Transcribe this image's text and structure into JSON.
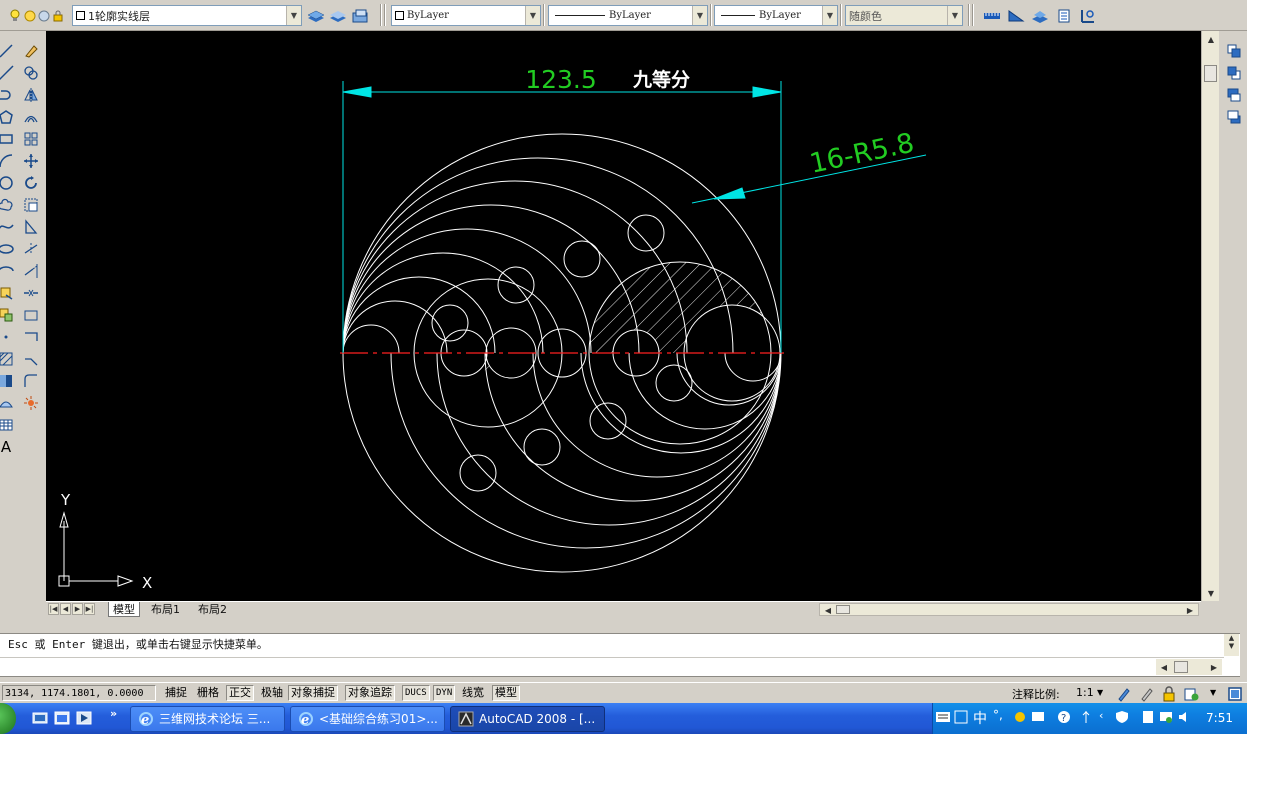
{
  "toolbar": {
    "layer_name": "1轮廓实线层",
    "color_combo": "ByLayer",
    "linetype_combo": "ByLayer",
    "lineweight_combo": "ByLayer",
    "plotstyle_combo": "随颜色"
  },
  "drawing": {
    "dimension_value": "123.5",
    "dimension_note": "九等分",
    "radius_label": "16-R5.8",
    "ucs_y": "Y",
    "ucs_x": "X",
    "colors": {
      "background": "#000000",
      "geometry": "#ffffff",
      "dimension": "#00ffff",
      "dim_text": "#00cc00",
      "centerline": "#ff0000"
    }
  },
  "tabs": [
    "模型",
    "布局1",
    "布局2"
  ],
  "command": {
    "line": "Esc 或 Enter 键退出，或单击右键显示快捷菜单。"
  },
  "status": {
    "coords": "3134, 1174.1801, 0.0000",
    "buttons": [
      {
        "label": "捕捉",
        "on": false
      },
      {
        "label": "栅格",
        "on": false
      },
      {
        "label": "正交",
        "on": true
      },
      {
        "label": "极轴",
        "on": false
      },
      {
        "label": "对象捕捉",
        "on": true
      },
      {
        "label": "对象追踪",
        "on": true
      },
      {
        "label": "DUCS",
        "on": true
      },
      {
        "label": "DYN",
        "on": true
      },
      {
        "label": "线宽",
        "on": false
      },
      {
        "label": "模型",
        "on": true
      }
    ],
    "annotation_scale_label": "注释比例:",
    "annotation_scale_value": "1:1"
  },
  "taskbar": {
    "tasks": [
      {
        "label": "三维网技术论坛 三...",
        "icon": "ie-icon",
        "active": false
      },
      {
        "label": "<基础综合练习01>...",
        "icon": "ie-icon",
        "active": false
      },
      {
        "label": "AutoCAD 2008 - [...",
        "icon": "autocad-icon",
        "active": true
      }
    ],
    "clock": "7:51",
    "ime": "中"
  }
}
